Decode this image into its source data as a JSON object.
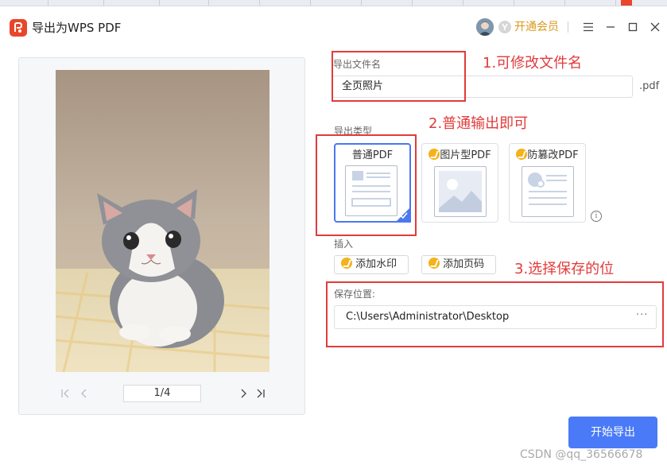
{
  "window": {
    "title": "导出为WPS PDF",
    "vip_label": "开通会员"
  },
  "filename": {
    "label": "导出文件名",
    "value": "全页照片",
    "suffix": ".pdf"
  },
  "export_type": {
    "label": "导出类型",
    "options": [
      {
        "label": "普通PDF",
        "selected": true
      },
      {
        "label": "图片型PDF",
        "selected": false,
        "premium": true
      },
      {
        "label": "防篡改PDF",
        "selected": false,
        "premium": true
      }
    ]
  },
  "insert": {
    "label": "插入",
    "watermark_label": "添加水印",
    "page_number_label": "添加页码"
  },
  "save": {
    "label": "保存位置:",
    "path": "C:\\Users\\Administrator\\Desktop",
    "more": "···"
  },
  "preview": {
    "page_indicator": "1/4"
  },
  "export_button": "开始导出",
  "annotations": {
    "a1": "1.可修改文件名",
    "a2": "2.普通输出即可",
    "a3": "3.选择保存的位"
  },
  "watermark_text": "CSDN @qq_36566678",
  "colors": {
    "accent": "#4a7af7",
    "annotation_red": "#e23b3b",
    "vip_gold": "#d99a1c"
  }
}
